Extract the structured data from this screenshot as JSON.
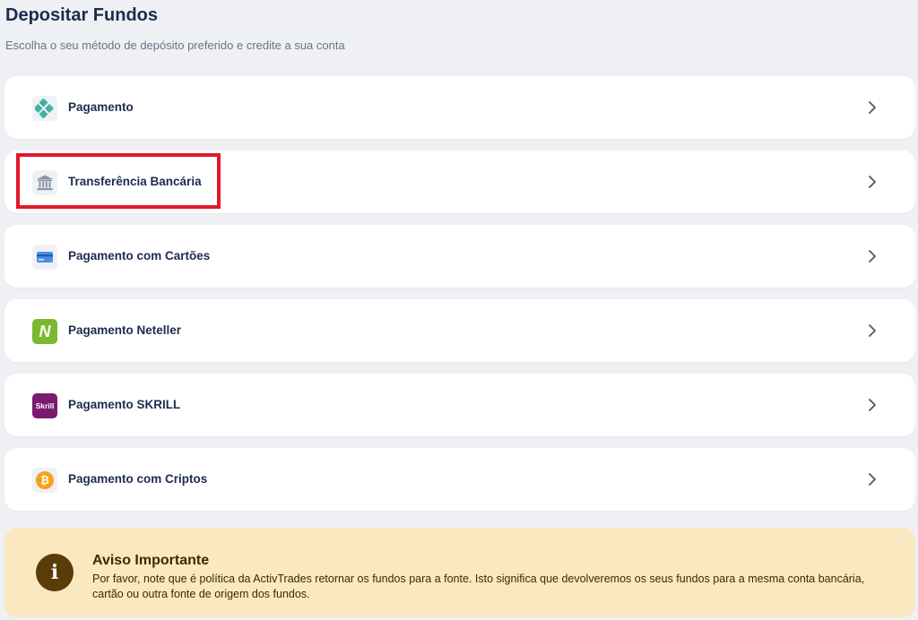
{
  "header": {
    "title": "Depositar Fundos",
    "subtitle": "Escolha o seu método de depósito preferido e credite a sua conta"
  },
  "methods": [
    {
      "label": "Pagamento",
      "icon": "pix-icon"
    },
    {
      "label": "Transferência Bancária",
      "icon": "bank-icon",
      "highlighted": true
    },
    {
      "label": "Pagamento com Cartões",
      "icon": "credit-card-icon"
    },
    {
      "label": "Pagamento Neteller",
      "icon": "neteller-logo-icon",
      "icon_text": "N"
    },
    {
      "label": "Pagamento SKRILL",
      "icon": "skrill-logo-icon",
      "icon_text": "Skrill"
    },
    {
      "label": "Pagamento com Criptos",
      "icon": "bitcoin-icon",
      "icon_text": "₿"
    }
  ],
  "notice": {
    "icon_text": "i",
    "title": "Aviso Importante",
    "text": "Por favor, note que é política da ActivTrades retornar os fundos para a fonte. Isto significa que devolveremos os seus fundos para a mesma conta bancária, cartão ou outra fonte de origem dos fundos."
  },
  "colors": {
    "background": "#eef0f4",
    "card": "#ffffff",
    "text_primary": "#1d2b4f",
    "highlight": "#e0182a",
    "notice_bg": "#f9e8c0",
    "notice_icon": "#5a3c08"
  }
}
